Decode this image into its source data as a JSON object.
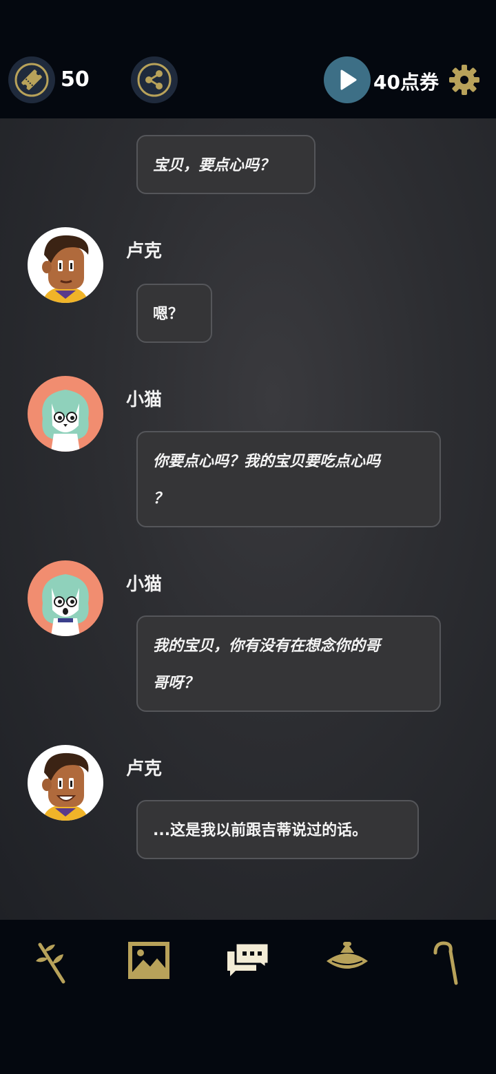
{
  "header": {
    "ticket_count": "50",
    "points_label": "40点券"
  },
  "messages": [
    {
      "text": "宝贝，要点心吗？"
    },
    {
      "speaker": "卢克",
      "text": "嗯？"
    },
    {
      "speaker": "小猫",
      "text_line1": "你要点心吗？我的宝贝要吃点心吗",
      "text_line2": "？"
    },
    {
      "speaker": "小猫",
      "text_line1": "我的宝贝，你有没有在想念你的哥",
      "text_line2": "哥呀？"
    },
    {
      "speaker": "卢克",
      "text": "...这是我以前跟吉蒂说过的话。"
    }
  ],
  "colors": {
    "accent_gold": "#b8a25a",
    "play_button": "#3d6f86",
    "cat_avatar_bg": "#f18d70"
  },
  "icons": {
    "nav": [
      "sprout-icon",
      "gallery-icon",
      "chat-icon",
      "hat-icon",
      "cane-icon"
    ]
  }
}
